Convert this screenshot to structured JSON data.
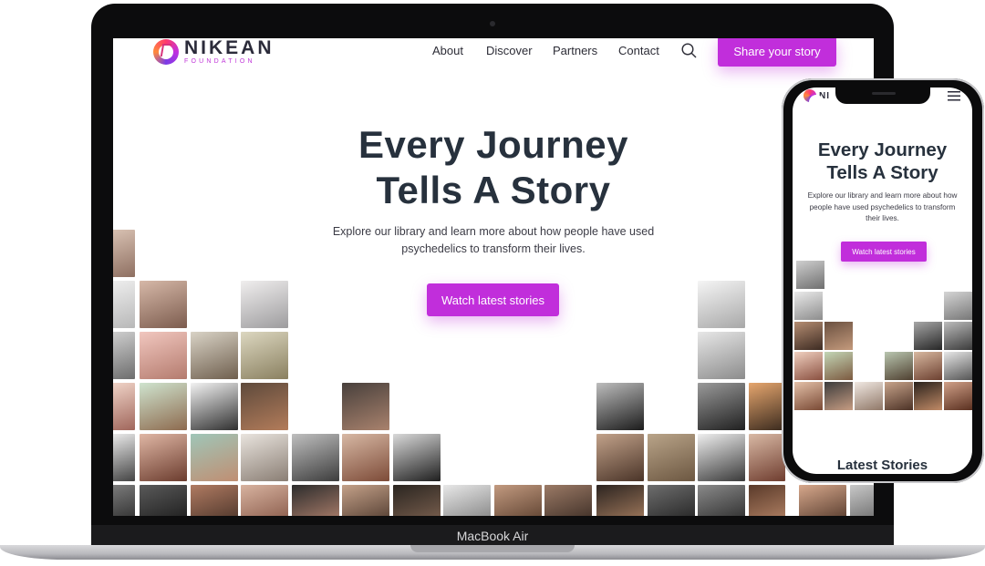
{
  "site": {
    "brand_name": "NIKEAN",
    "brand_sub": "FOUNDATION",
    "nav": [
      "About",
      "Discover",
      "Partners",
      "Contact"
    ],
    "cta": "Share your story",
    "hero_line1": "Every Journey",
    "hero_line2": "Tells A Story",
    "hero_desc_line1": "Explore our library and learn more about how people have used",
    "hero_desc_line2": "psychedelics to transform their lives.",
    "hero_button": "Watch latest stories"
  },
  "laptop": {
    "brand_label": "MacBook Air"
  },
  "phone": {
    "brand_partial": "NI",
    "hero_line1": "Every Journey",
    "hero_line2": "Tells A Story",
    "desc_line1": "Explore our library and learn more about how",
    "desc_line2": "people have used psychedelics to transform",
    "desc_line3": "their lives.",
    "button": "Watch latest stories",
    "section_title": "Latest Stories"
  },
  "colors": {
    "accent": "#c12edb",
    "heading": "#27313d"
  },
  "icons": {
    "search": "search-icon",
    "menu": "hamburger-menu-icon",
    "logo": "logo-icon"
  }
}
